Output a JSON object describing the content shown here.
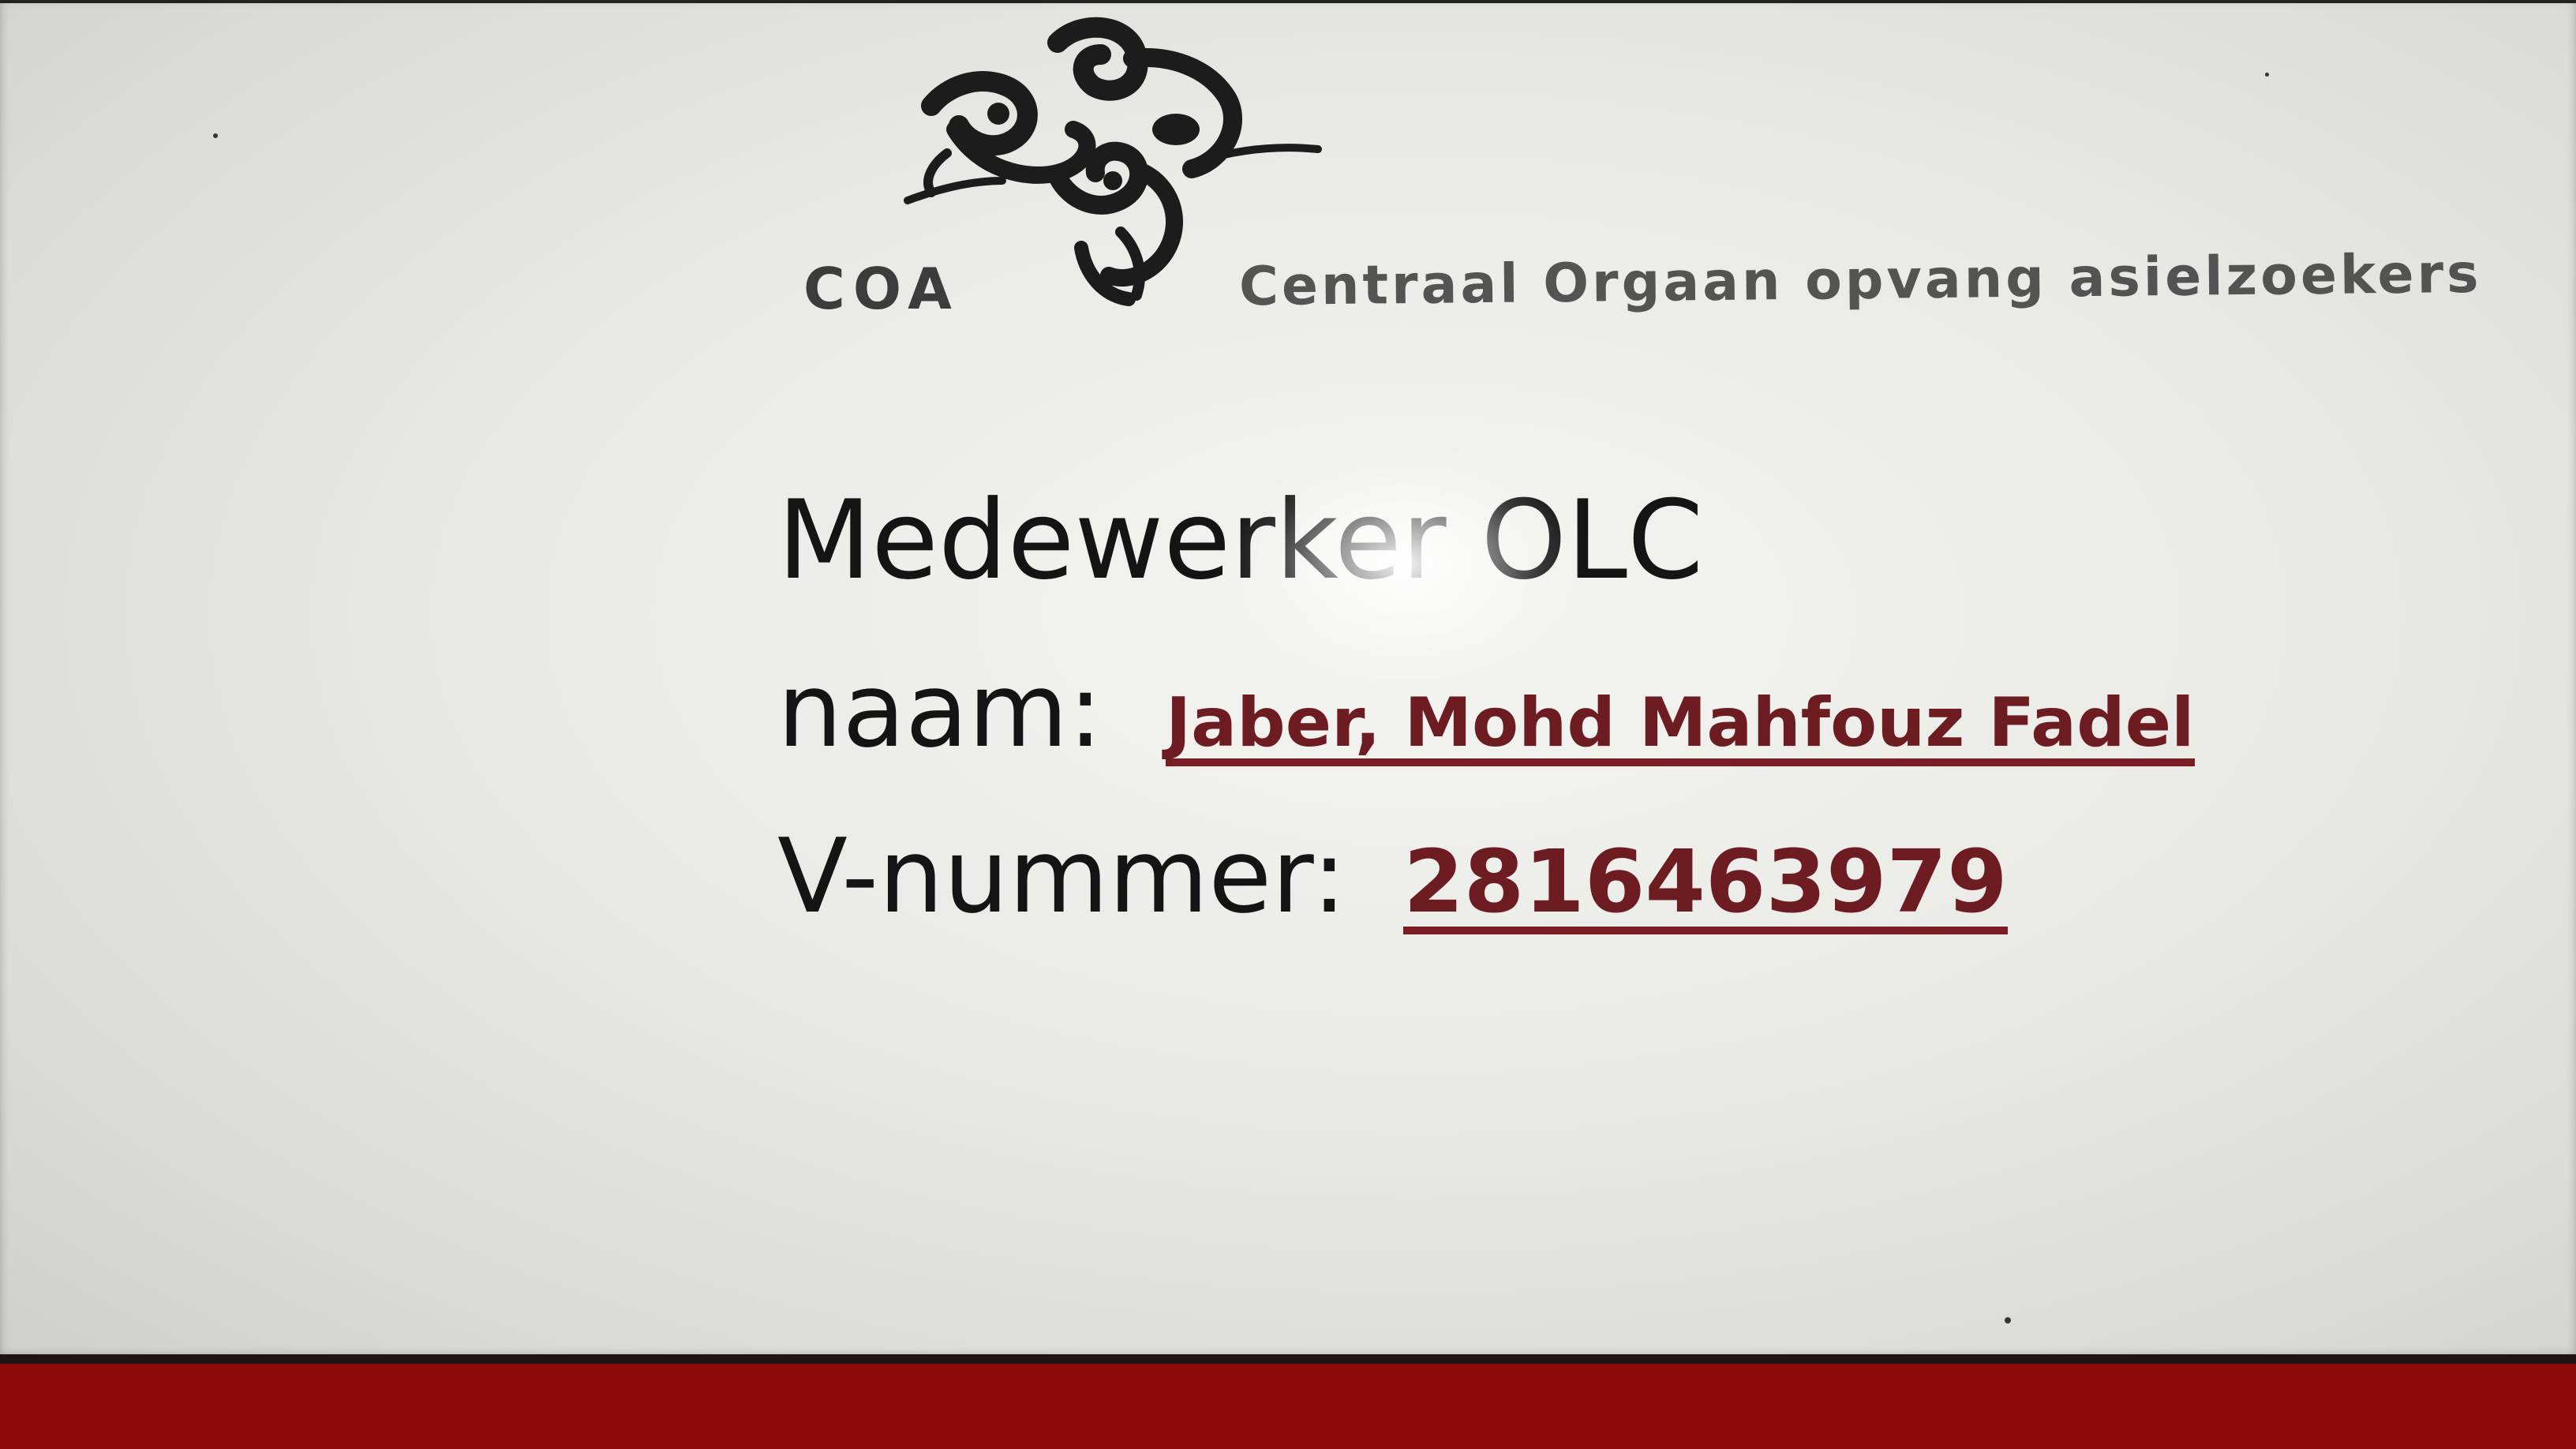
{
  "card": {
    "logo": {
      "icon": "coa-figures-logo",
      "abbreviation": "COA",
      "organization": "Centraal Orgaan opvang asielzoekers"
    },
    "role": "Medewerker OLC",
    "name_label": "naam:",
    "name_value": "Jaber, Mohd Mahfouz Fadel",
    "vnumber_label": "V-nummer:",
    "vnumber_value": "2816463979"
  },
  "colors": {
    "card_background": "#ecece9",
    "text_primary": "#141414",
    "text_value": "#6d1d22",
    "surface_red": "#8a0b08"
  }
}
